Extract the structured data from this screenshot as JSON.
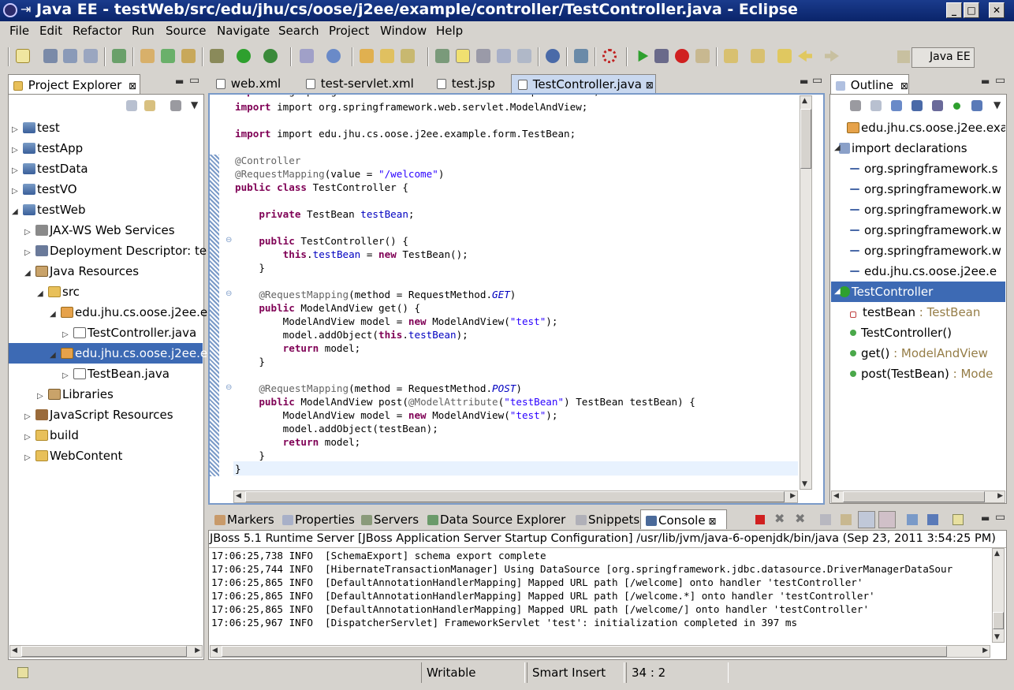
{
  "window": {
    "title": "Java EE - testWeb/src/edu/jhu/cs/oose/j2ee/example/controller/TestController.java - Eclipse"
  },
  "menu": [
    "File",
    "Edit",
    "Refactor",
    "Run",
    "Source",
    "Navigate",
    "Search",
    "Project",
    "Window",
    "Help"
  ],
  "perspective": {
    "label": "Java EE"
  },
  "project_explorer": {
    "title": "Project Explorer",
    "items": [
      {
        "label": "test",
        "icon": "project-icon",
        "twisty": "▷"
      },
      {
        "label": "testApp",
        "icon": "project-icon",
        "twisty": "▷"
      },
      {
        "label": "testData",
        "icon": "project-icon",
        "twisty": "▷"
      },
      {
        "label": "testVO",
        "icon": "project-icon",
        "twisty": "▷"
      },
      {
        "label": "testWeb",
        "icon": "project-icon",
        "twisty": "◢"
      },
      {
        "label": "JAX-WS Web Services",
        "icon": "web-services-icon",
        "twisty": "▷"
      },
      {
        "label": "Deployment Descriptor: te",
        "icon": "deployment-descriptor-icon",
        "twisty": "▷"
      },
      {
        "label": "Java Resources",
        "icon": "java-resources-icon",
        "twisty": "◢"
      },
      {
        "label": "src",
        "icon": "source-folder-icon",
        "twisty": "◢"
      },
      {
        "label": "edu.jhu.cs.oose.j2ee.e",
        "icon": "package-icon",
        "twisty": "◢"
      },
      {
        "label": "TestController.java",
        "icon": "java-file-icon",
        "twisty": "▷"
      },
      {
        "label": "edu.jhu.cs.oose.j2ee.e",
        "icon": "package-icon",
        "twisty": "◢"
      },
      {
        "label": "TestBean.java",
        "icon": "java-file-icon",
        "twisty": "▷"
      },
      {
        "label": "Libraries",
        "icon": "libraries-icon",
        "twisty": "▷"
      },
      {
        "label": "JavaScript Resources",
        "icon": "javascript-resources-icon",
        "twisty": "▷"
      },
      {
        "label": "build",
        "icon": "folder-icon",
        "twisty": "▷"
      },
      {
        "label": "WebContent",
        "icon": "folder-icon",
        "twisty": "▷"
      }
    ]
  },
  "editor": {
    "tabs": [
      "web.xml",
      "test-servlet.xml",
      "test.jsp",
      "TestController.java"
    ],
    "close_glyph": "⊠"
  },
  "outline": {
    "title": "Outline",
    "items": [
      {
        "label": "edu.jhu.cs.oose.j2ee.exa",
        "type": ""
      },
      {
        "label": "import declarations",
        "type": ""
      },
      {
        "label": "org.springframework.s",
        "type": ""
      },
      {
        "label": "org.springframework.w",
        "type": ""
      },
      {
        "label": "org.springframework.w",
        "type": ""
      },
      {
        "label": "org.springframework.w",
        "type": ""
      },
      {
        "label": "org.springframework.w",
        "type": ""
      },
      {
        "label": "edu.jhu.cs.oose.j2ee.e",
        "type": ""
      },
      {
        "label": "TestController",
        "type": ""
      },
      {
        "label": "testBean",
        "type": " : TestBean"
      },
      {
        "label": "TestController()",
        "type": ""
      },
      {
        "label": "get()",
        "type": " : ModelAndView"
      },
      {
        "label": "post(TestBean)",
        "type": " : Mode"
      }
    ]
  },
  "bottom_tabs": [
    "Markers",
    "Properties",
    "Servers",
    "Data Source Explorer",
    "Snippets",
    "Console"
  ],
  "console": {
    "header": "JBoss 5.1 Runtime Server [JBoss Application Server Startup Configuration] /usr/lib/jvm/java-6-openjdk/bin/java (Sep 23, 2011 3:54:25 PM)",
    "lines": [
      "17:06:25,738 INFO  [SchemaExport] schema export complete",
      "17:06:25,744 INFO  [HibernateTransactionManager] Using DataSource [org.springframework.jdbc.datasource.DriverManagerDataSour",
      "17:06:25,865 INFO  [DefaultAnnotationHandlerMapping] Mapped URL path [/welcome] onto handler 'testController'",
      "17:06:25,865 INFO  [DefaultAnnotationHandlerMapping] Mapped URL path [/welcome.*] onto handler 'testController'",
      "17:06:25,865 INFO  [DefaultAnnotationHandlerMapping] Mapped URL path [/welcome/] onto handler 'testController'",
      "17:06:25,967 INFO  [DispatcherServlet] FrameworkServlet 'test': initialization completed in 397 ms"
    ]
  },
  "status": {
    "writable": "Writable",
    "insert_mode": "Smart Insert",
    "position": "34 : 2"
  },
  "code": {
    "l0": "import org.springframework.web.servlet.ModelAndView;",
    "l1": "import edu.jhu.cs.oose.j2ee.example.form.TestBean;",
    "l2": "@Controller",
    "l3a": "@RequestMapping",
    "l3b": "(value = ",
    "l3c": "\"/welcome\"",
    "l3d": ")",
    "l4": "public class TestController {",
    "l5a": "    private TestBean ",
    "l5b": "testBean",
    "l5c": ";",
    "l6": "    public TestController() {",
    "l7a": "        this.",
    "l7b": "testBean",
    "l7c": " = new TestBean();",
    "l8": "    }",
    "l9a": "    @RequestMapping",
    "l9b": "(method = RequestMethod.",
    "l9c": "GET",
    "l9d": ")",
    "l10": "    public ModelAndView get() {",
    "l11a": "        ModelAndView model = new ModelAndView(",
    "l11b": "\"test\"",
    "l11c": ");",
    "l12a": "        model.addObject(this.",
    "l12b": "testBean",
    "l12c": ");",
    "l13": "        return model;",
    "l14": "    }",
    "l15a": "    @RequestMapping",
    "l15b": "(method = RequestMethod.",
    "l15c": "POST",
    "l15d": ")",
    "l16a": "    public ModelAndView post(",
    "l16b": "@ModelAttribute",
    "l16c": "(",
    "l16d": "\"testBean\"",
    "l16e": ") TestBean testBean) {",
    "l17a": "        ModelAndView model = new ModelAndView(",
    "l17b": "\"test\"",
    "l17c": ");",
    "l18": "        model.addObject(testBean);",
    "l19": "        return model;",
    "l20": "    }",
    "l21": "}"
  }
}
